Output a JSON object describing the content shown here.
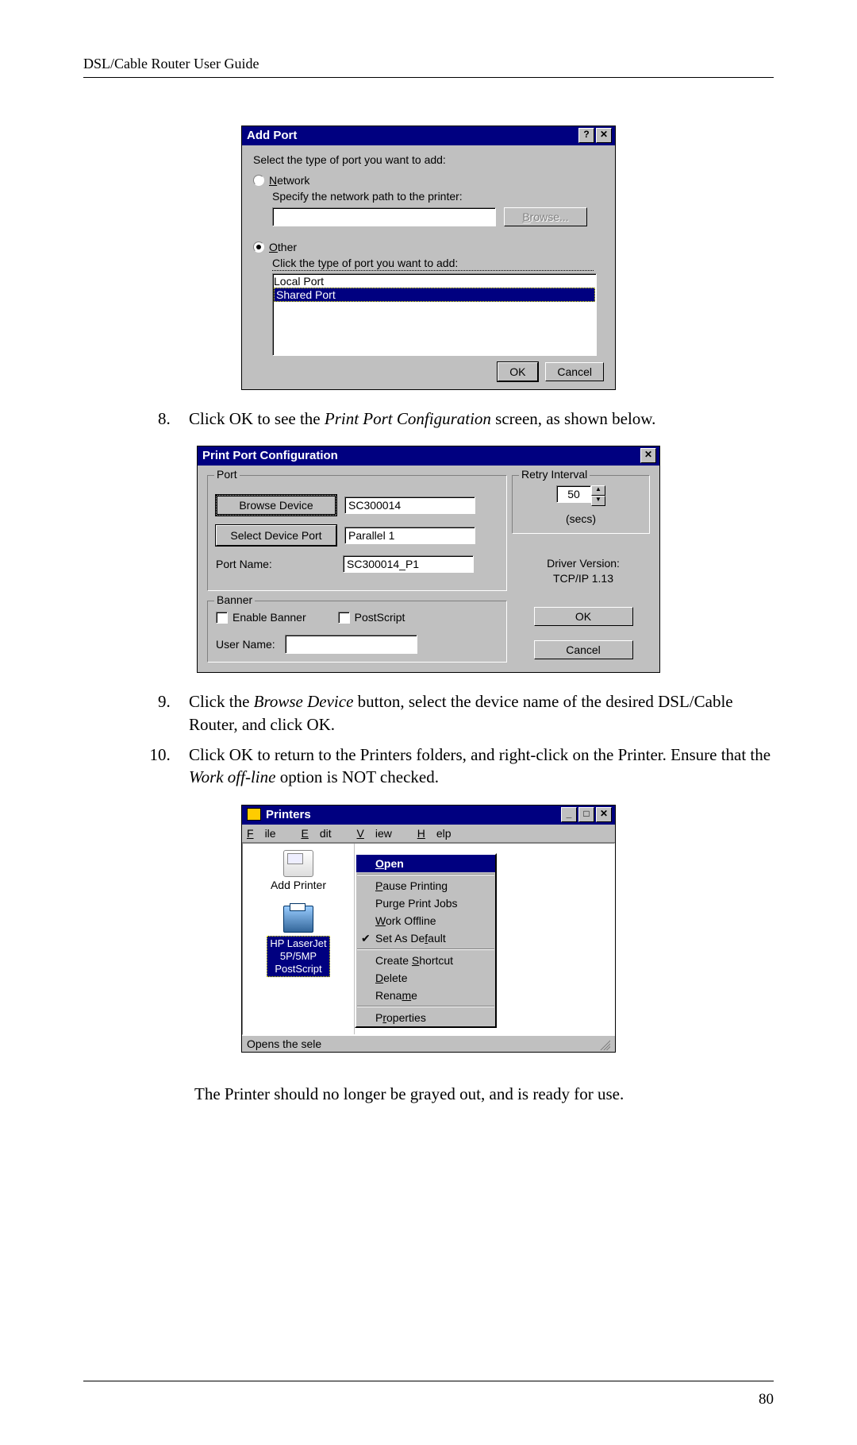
{
  "header": {
    "title": "DSL/Cable Router User Guide"
  },
  "page_number": "80",
  "addport": {
    "title": "Add Port",
    "help_btn": "?",
    "close_btn": "✕",
    "prompt": "Select the type of port you want to add:",
    "network": {
      "label_u": "N",
      "label_rest": "etwork",
      "selected": false,
      "hint": "Specify the network path to the printer:",
      "path_value": "",
      "browse_u": "B",
      "browse_rest": "rowse..."
    },
    "other": {
      "label_u": "O",
      "label_rest": "ther",
      "selected": true,
      "hint": "Click the type of port you want to add:",
      "list": [
        "Local Port",
        "Shared Port"
      ],
      "selected_index": 1
    },
    "ok": "OK",
    "cancel": "Cancel"
  },
  "step8_a": "Click OK to see the ",
  "step8_i": "Print Port Configuration",
  "step8_b": " screen, as shown below.",
  "ppc": {
    "title": "Print Port Configuration",
    "close_btn": "✕",
    "port_legend": "Port",
    "browse_device": "Browse Device",
    "device_value": "SC300014",
    "select_port": "Select Device Port",
    "port_value": "Parallel 1",
    "port_name_label": "Port Name:",
    "port_name_value": "SC300014_P1",
    "retry_legend": "Retry Interval",
    "retry_value": "50",
    "retry_units": "(secs)",
    "version_l1": "Driver Version:",
    "version_l2": "TCP/IP  1.13",
    "banner_legend": "Banner",
    "enable_banner": "Enable Banner",
    "postscript": "PostScript",
    "user_name_label": "User Name:",
    "user_name_value": "",
    "ok": "OK",
    "cancel": "Cancel"
  },
  "step9_a": "Click the ",
  "step9_i": "Browse Device",
  "step9_b": " button, select the device name of the desired DSL/Cable Router, and click OK.",
  "step10_a": "Click OK to return to the Printers folders, and right-click on the Printer. Ensure that the ",
  "step10_i": "Work off-line",
  "step10_b": " option is NOT checked.",
  "printers": {
    "title": "Printers",
    "min_btn": "_",
    "max_btn": "□",
    "close_btn": "✕",
    "menu": {
      "file_u": "F",
      "file_r": "ile",
      "edit_u": "E",
      "edit_r": "dit",
      "view_u": "V",
      "view_r": "iew",
      "help_u": "H",
      "help_r": "elp"
    },
    "add_printer_label": "Add Printer",
    "selected_printer_l1": "HP LaserJet",
    "selected_printer_l2": "5P/5MP",
    "selected_printer_l3": "PostScript",
    "ctx": {
      "open_u": "O",
      "open_r": "pen",
      "pause_u": "P",
      "pause_r": "ause Printing",
      "purge_pre": "Pur",
      "purge_u": "g",
      "purge_post": "e Print Jobs",
      "work_u": "W",
      "work_r": "ork Offline",
      "default_pre": "Set As De",
      "default_u": "f",
      "default_post": "ault",
      "shortcut_pre": "Create ",
      "shortcut_u": "S",
      "shortcut_post": "hortcut",
      "delete_u": "D",
      "delete_r": "elete",
      "rename_pre": "Rena",
      "rename_u": "m",
      "rename_post": "e",
      "props_pre": "P",
      "props_u": "r",
      "props_post": "operties"
    },
    "status": "Opens the sele"
  },
  "closing": "The Printer should no longer be grayed out, and is ready for use."
}
